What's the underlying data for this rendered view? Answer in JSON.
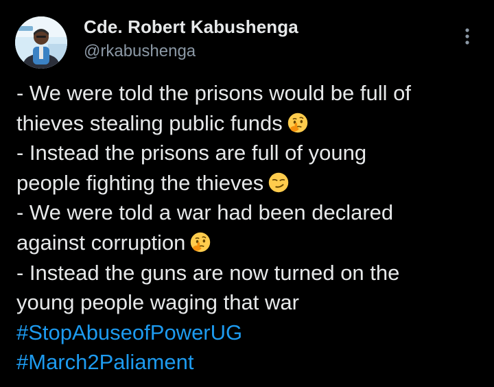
{
  "author": {
    "display_name": "Cde. Robert Kabushenga",
    "handle": "@rkabushenga",
    "avatar": "avatar-photo"
  },
  "menu": {
    "icon": "more-vertical-icon"
  },
  "post": {
    "lines": [
      {
        "text": "- We were told the prisons would be full of",
        "emoji": null
      },
      {
        "text": "thieves stealing public funds",
        "emoji": "thinking-face-emoji"
      },
      {
        "text": "- Instead the prisons are full of young",
        "emoji": null
      },
      {
        "text": "people fighting the thieves",
        "emoji": "smirking-face-emoji"
      },
      {
        "text": "- We were told a war had been declared",
        "emoji": null
      },
      {
        "text": "against corruption",
        "emoji": "thinking-face-emoji"
      },
      {
        "text": "- Instead the guns are now turned on the",
        "emoji": null
      },
      {
        "text": "young people waging that war",
        "emoji": null
      }
    ],
    "hashtags": [
      "#StopAbuseofPowerUG",
      "#March2Paliament"
    ]
  },
  "colors": {
    "background": "#000000",
    "text": "#e7e9ea",
    "secondary": "#8b98a5",
    "link": "#1d9bf0"
  }
}
